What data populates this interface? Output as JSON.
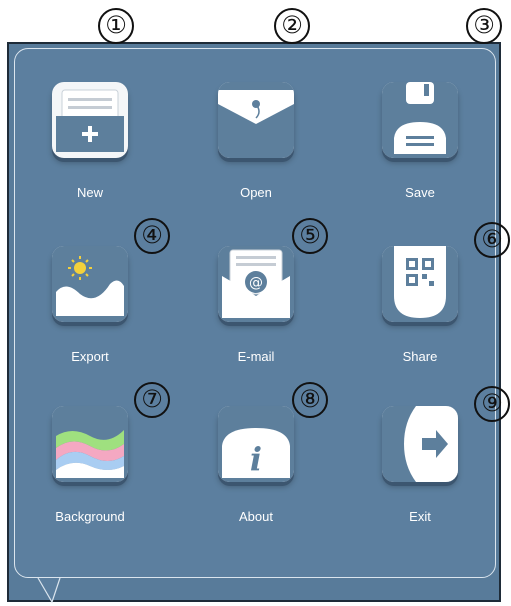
{
  "menu": {
    "items": [
      {
        "label": "New",
        "marker": "①",
        "icon": "new-document-icon"
      },
      {
        "label": "Open",
        "marker": "②",
        "icon": "open-envelope-icon"
      },
      {
        "label": "Save",
        "marker": "③",
        "icon": "floppy-disk-icon"
      },
      {
        "label": "Export",
        "marker": "④",
        "icon": "landscape-image-icon"
      },
      {
        "label": "E-mail",
        "marker": "⑤",
        "icon": "email-envelope-icon"
      },
      {
        "label": "Share",
        "marker": "⑥",
        "icon": "qr-code-icon"
      },
      {
        "label": "Background",
        "marker": "⑦",
        "icon": "color-waves-icon"
      },
      {
        "label": "About",
        "marker": "⑧",
        "icon": "info-icon"
      },
      {
        "label": "Exit",
        "marker": "⑨",
        "icon": "exit-arrow-icon"
      }
    ]
  },
  "colors": {
    "panel": "#5c7f9f",
    "tile": "#f4f6f8",
    "label": "#ffffff"
  }
}
